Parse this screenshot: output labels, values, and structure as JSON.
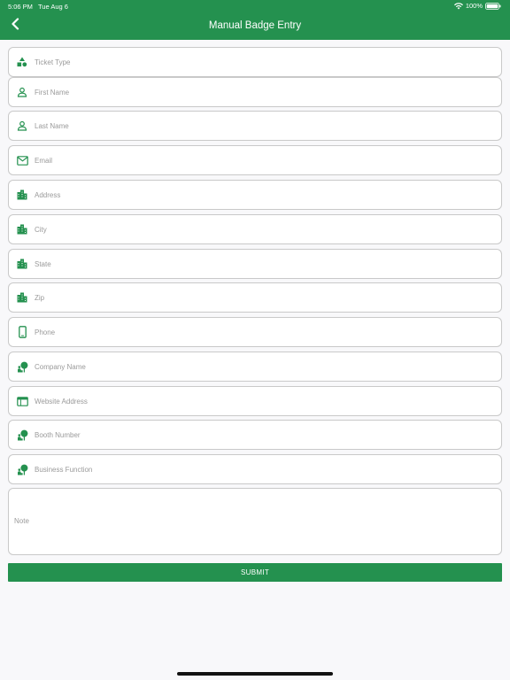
{
  "status_bar": {
    "time": "5:06 PM",
    "date": "Tue Aug 6",
    "battery": "100%"
  },
  "header": {
    "title": "Manual Badge Entry",
    "back_icon": "chevron-left-icon"
  },
  "colors": {
    "accent": "#24914f",
    "background": "#f8f8fa",
    "field_border": "#c9c9c9"
  },
  "form": {
    "fields": [
      {
        "id": "ticket-type",
        "placeholder": "Ticket Type",
        "value": "",
        "icon": "shapes-icon"
      },
      {
        "id": "first-name",
        "placeholder": "First Name",
        "value": "",
        "icon": "person-icon"
      },
      {
        "id": "last-name",
        "placeholder": "Last Name",
        "value": "",
        "icon": "person-icon"
      },
      {
        "id": "email",
        "placeholder": "Email",
        "value": "",
        "icon": "mail-icon"
      },
      {
        "id": "address",
        "placeholder": "Address",
        "value": "",
        "icon": "city-icon"
      },
      {
        "id": "city",
        "placeholder": "City",
        "value": "",
        "icon": "city-icon"
      },
      {
        "id": "state",
        "placeholder": "State",
        "value": "",
        "icon": "city-icon"
      },
      {
        "id": "zip",
        "placeholder": "Zip",
        "value": "",
        "icon": "city-icon"
      },
      {
        "id": "phone",
        "placeholder": "Phone",
        "value": "",
        "icon": "phone-icon"
      },
      {
        "id": "company-name",
        "placeholder": "Company Name",
        "value": "",
        "icon": "nature-person-icon"
      },
      {
        "id": "website-address",
        "placeholder": "Website Address",
        "value": "",
        "icon": "web-icon"
      },
      {
        "id": "booth-number",
        "placeholder": "Booth Number",
        "value": "",
        "icon": "nature-person-icon"
      },
      {
        "id": "business-function",
        "placeholder": "Business Function",
        "value": "",
        "icon": "nature-person-icon"
      }
    ],
    "note": {
      "placeholder": "Note",
      "value": ""
    },
    "submit_label": "SUBMIT"
  }
}
